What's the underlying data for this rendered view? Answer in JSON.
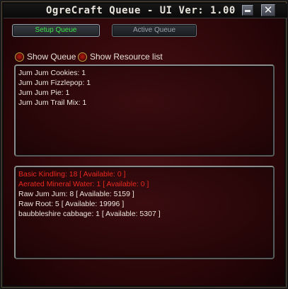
{
  "window": {
    "title": "OgreCraft Queue - UI Ver: 1.00"
  },
  "tabs": [
    {
      "label": "Setup Queue",
      "active": true
    },
    {
      "label": "Active Queue",
      "active": false
    }
  ],
  "options": [
    {
      "label": "Show Queue",
      "checked": false
    },
    {
      "label": "Show Resource list",
      "checked": false
    }
  ],
  "queue_items": [
    "Jum Jum Cookies: 1",
    "Jum Jum Fizzlepop: 1",
    "Jum Jum Pie: 1",
    "Jum Jum Trail Mix: 1"
  ],
  "resources": [
    {
      "text": "Basic Kindling: 18   [ Available: 0 ]",
      "missing": true
    },
    {
      "text": "Aerated Mineral Water: 1   [ Available: 0 ]",
      "missing": true
    },
    {
      "text": "Raw Jum Jum: 8   [ Available: 5159 ]",
      "missing": false
    },
    {
      "text": "Raw Root: 5   [ Available: 19996 ]",
      "missing": false
    },
    {
      "text": "baubbleshire cabbage: 1   [ Available: 5307 ]",
      "missing": false
    }
  ],
  "colors": {
    "active_tab_text": "#3ee64a",
    "missing_resource": "#e8281e",
    "normal_text": "#ece6dc"
  },
  "icons": {
    "minimize": "minimize-icon",
    "close": "close-icon"
  }
}
